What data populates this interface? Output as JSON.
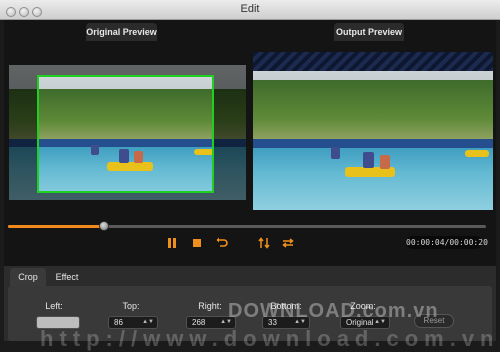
{
  "window": {
    "title": "Edit"
  },
  "previews": {
    "original_label": "Original Preview",
    "output_label": "Output Preview"
  },
  "playback": {
    "progress": 0.2,
    "time": "00:00:04/00:00:20",
    "controls": [
      "play-pause-icon",
      "stop-icon",
      "rewind-icon",
      "flip-vertical-icon",
      "flip-horizontal-icon"
    ]
  },
  "tabs": {
    "crop": "Crop",
    "effect": "Effect",
    "active": "crop"
  },
  "crop": {
    "left_label": "Left:",
    "left_value": "",
    "top_label": "Top:",
    "top_value": "86",
    "right_label": "Right:",
    "right_value": "268",
    "bottom_label": "Bottom:",
    "bottom_value": "33",
    "zoom_label": "Zoom:",
    "zoom_value": "Original",
    "reset_label": "Reset"
  },
  "watermark": {
    "text": "DOWNLOAD.com.vn",
    "url_text": "http://www.download.com.vn"
  },
  "colors": {
    "accent": "#f08a1c",
    "crop_border": "#1fd01f",
    "background": "#141414"
  }
}
